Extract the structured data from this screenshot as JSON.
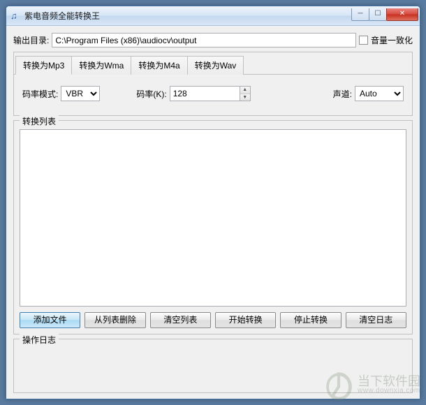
{
  "window": {
    "title": "紫电音频全能转换王"
  },
  "output": {
    "label": "输出目录:",
    "value": "C:\\Program Files (x86)\\audiocv\\output"
  },
  "normalize": {
    "checked": false,
    "label": "音量一致化"
  },
  "tabs": [
    {
      "label": "转换为Mp3",
      "active": true
    },
    {
      "label": "转换为Wma",
      "active": false
    },
    {
      "label": "转换为M4a",
      "active": false
    },
    {
      "label": "转换为Wav",
      "active": false
    }
  ],
  "mp3": {
    "bitrate_mode_label": "码率模式:",
    "bitrate_mode_value": "VBR",
    "bitrate_k_label": "码率(K):",
    "bitrate_k_value": "128",
    "channel_label": "声道:",
    "channel_value": "Auto"
  },
  "list": {
    "title": "转换列表"
  },
  "buttons": {
    "add": "添加文件",
    "remove": "从列表删除",
    "clear_list": "清空列表",
    "start": "开始转换",
    "stop": "停止转换",
    "clear_log": "清空日志"
  },
  "log": {
    "title": "操作日志"
  },
  "watermark": {
    "name": "当下软件园",
    "url": "www.downxia.com"
  }
}
